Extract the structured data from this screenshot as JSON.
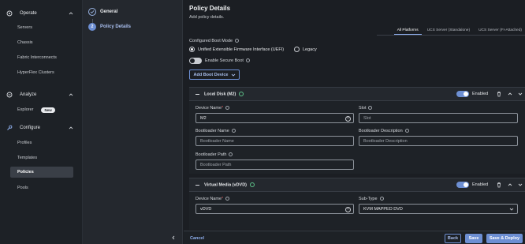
{
  "nav": {
    "operate": {
      "label": "Operate",
      "items": [
        "Servers",
        "Chassis",
        "Fabric Interconnects",
        "HyperFlex Clusters"
      ]
    },
    "analyze": {
      "label": "Analyze",
      "items": [
        "Explorer"
      ],
      "explorer_badge": "New"
    },
    "configure": {
      "label": "Configure",
      "items": [
        "Profiles",
        "Templates",
        "Policies",
        "Pools"
      ],
      "active": "Policies"
    }
  },
  "steps": [
    {
      "label": "General",
      "state": "done"
    },
    {
      "number": "2",
      "label": "Policy Details",
      "state": "current"
    }
  ],
  "page": {
    "title": "Policy Details",
    "subtitle": "Add policy details."
  },
  "platform_tabs": [
    "All Platforms",
    "UCS Server (Standalone)",
    "UCS Server (FI-Attached)"
  ],
  "boot": {
    "mode_label": "Configured Boot Mode",
    "options": [
      "Unified Extensible Firmware Interface (UEFI)",
      "Legacy"
    ],
    "selected": "Unified Extensible Firmware Interface (UEFI)",
    "secure_boot_label": "Enable Secure Boot",
    "secure_boot_enabled": false,
    "add_boot_device": "Add Boot Device"
  },
  "local_disk": {
    "title": "Local Disk (M2)",
    "enabled_label": "Enabled",
    "enabled": true,
    "device_name_label": "Device Name",
    "device_name_value": "M2",
    "slot_label": "Slot",
    "slot_placeholder": "Slot",
    "bootloader_name_label": "Bootloader Name",
    "bootloader_name_placeholder": "Bootloader Name",
    "bootloader_desc_label": "Bootloader Description",
    "bootloader_desc_placeholder": "Bootloader Description",
    "bootloader_path_label": "Bootloader Path",
    "bootloader_path_placeholder": "Bootloader Path"
  },
  "virtual_media": {
    "title": "Virtual Media (vDVD)",
    "enabled_label": "Enabled",
    "enabled": true,
    "device_name_label": "Device Name",
    "device_name_value": "vDVD",
    "subtype_label": "Sub-Type",
    "subtype_value": "KVM MAPPED DVD"
  },
  "footer": {
    "cancel": "Cancel",
    "back": "Back",
    "save": "Save",
    "save_deploy": "Save & Deploy"
  },
  "colors": {
    "accent": "#6d8fd3",
    "success": "#5ec48a",
    "required": "#e05a5a"
  }
}
